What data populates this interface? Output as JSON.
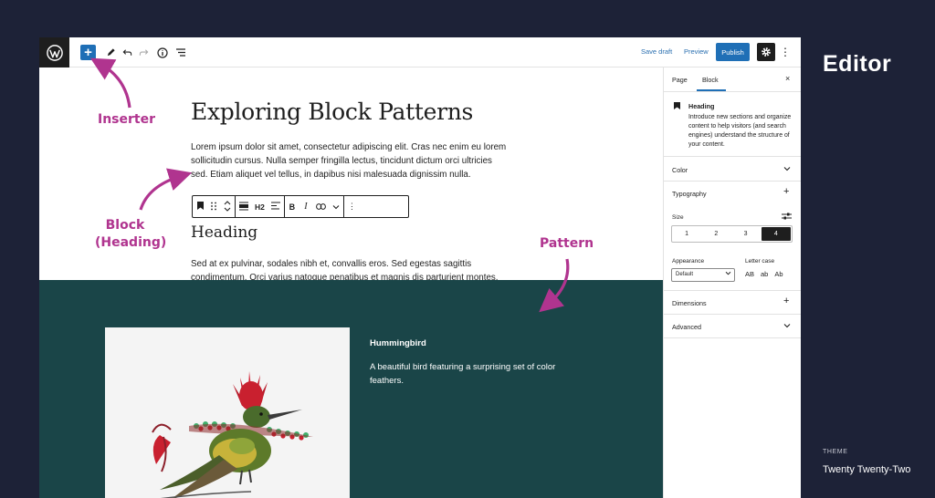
{
  "topbar": {
    "save_draft": "Save draft",
    "preview": "Preview",
    "publish": "Publish",
    "icons": [
      "wordpress-logo",
      "plus-icon",
      "pencil-icon",
      "undo-icon",
      "redo-icon",
      "info-icon",
      "list-view-icon",
      "gear-icon",
      "more-vertical-icon"
    ]
  },
  "content": {
    "title": "Exploring Block Patterns",
    "paragraph1": "Lorem ipsum dolor sit amet, consectetur adipiscing elit. Cras nec enim eu lorem sollicitudin cursus. Nulla semper fringilla lectus, tincidunt dictum orci ultricies sed. Etiam aliquet vel tellus, in dapibus nisi malesuada dignissim nulla.",
    "heading": "Heading",
    "paragraph2": "Sed at ex pulvinar, sodales nibh et, convallis eros. Sed egestas sagittis condimentum. Orci varius natoque penatibus et magnis dis parturient montes, nascetur ridiculus mus."
  },
  "block_toolbar": {
    "heading_level": "H2"
  },
  "pattern": {
    "title": "Hummingbird",
    "description": "A beautiful bird featuring a surprising set of color feathers.",
    "background": "#1a4548"
  },
  "sidebar": {
    "tabs": [
      "Page",
      "Block"
    ],
    "active_tab": "Block",
    "close": "×",
    "block_card": {
      "name": "Heading",
      "description": "Introduce new sections and organize content to help visitors (and search engines) understand the structure of your content."
    },
    "panels": {
      "color": "Color",
      "typography": "Typography",
      "size_label": "Size",
      "sizes": [
        "1",
        "2",
        "3",
        "4"
      ],
      "active_size": "4",
      "appearance_label": "Appearance",
      "appearance_value": "Default",
      "lettercase_label": "Letter case",
      "lettercase_options": [
        "AB",
        "ab",
        "Ab"
      ],
      "dimensions": "Dimensions",
      "advanced": "Advanced"
    }
  },
  "annotations": {
    "inserter": "Inserter",
    "block_line1": "Block",
    "block_line2": "(Heading)",
    "pattern": "Pattern"
  },
  "right_panel": {
    "editor_label": "Editor",
    "theme_caption": "THEME",
    "theme_name": "Twenty Twenty-Two"
  },
  "colors": {
    "accent": "#1f6fb6",
    "annotation": "#b0348f",
    "page_background": "#1d2237"
  }
}
